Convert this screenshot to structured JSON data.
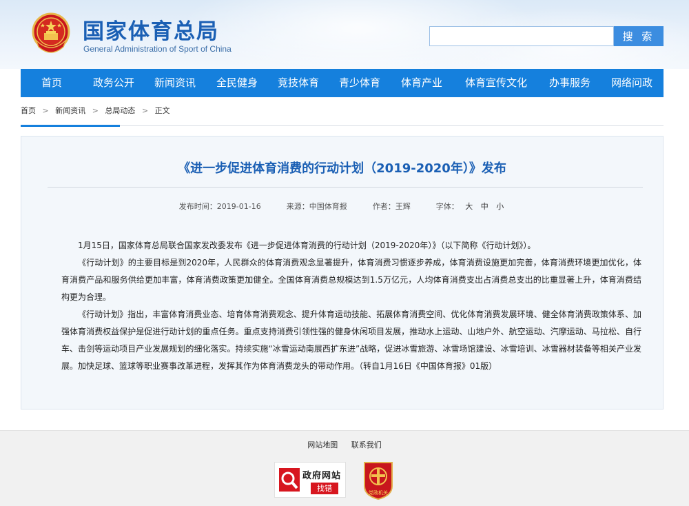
{
  "header": {
    "site_title": "国家体育总局",
    "site_subtitle": "General Administration of Sport of China",
    "search_placeholder": "",
    "search_button": "搜 索"
  },
  "nav": {
    "items": [
      "首页",
      "政务公开",
      "新闻资讯",
      "全民健身",
      "竞技体育",
      "青少体育",
      "体育产业",
      "体育宣传文化",
      "办事服务",
      "网络问政"
    ]
  },
  "breadcrumb": {
    "items": [
      "首页",
      "新闻资讯",
      "总局动态",
      "正文"
    ],
    "separator": ">"
  },
  "article": {
    "title": "《进一步促进体育消费的行动计划（2019-2020年）》发布",
    "publish_time_label": "发布时间：",
    "publish_time": "2019-01-16",
    "source_label": "来源：",
    "source": "中国体育报",
    "author_label": "作者：",
    "author": "王辉",
    "font_size_label": "字体：",
    "font_sizes": [
      "大",
      "中",
      "小"
    ],
    "paragraphs": [
      "1月15日，国家体育总局联合国家发改委发布《进一步促进体育消费的行动计划（2019-2020年）》（以下简称《行动计划》）。",
      "《行动计划》的主要目标是到2020年，人民群众的体育消费观念显著提升，体育消费习惯逐步养成，体育消费设施更加完善，体育消费环境更加优化，体育消费产品和服务供给更加丰富，体育消费政策更加健全。全国体育消费总规模达到1.5万亿元，人均体育消费支出占消费总支出的比重显著上升，体育消费结构更为合理。",
      "《行动计划》指出，丰富体育消费业态、培育体育消费观念、提升体育运动技能、拓展体育消费空间、优化体育消费发展环境、健全体育消费政策体系、加强体育消费权益保护是促进行动计划的重点任务。重点支持消费引领性强的健身休闲项目发展，推动水上运动、山地户外、航空运动、汽摩运动、马拉松、自行车、击剑等运动项目产业发展规划的细化落实。持续实施“冰雪运动南展西扩东进”战略，促进冰雪旅游、冰雪场馆建设、冰雪培训、冰雪器材装备等相关产业发展。加快足球、篮球等职业赛事改革进程，发挥其作为体育消费龙头的带动作用。（转自1月16日《中国体育报》01版）"
    ]
  },
  "footer": {
    "links": [
      "网站地图",
      "联系我们"
    ],
    "gov_badge_line1": "政府网站",
    "gov_badge_line2": "找错",
    "party_badge_text": "党政机关"
  },
  "colors": {
    "primary_blue": "#1580dd",
    "title_blue": "#1a5fb4",
    "badge_red": "#d7161f"
  }
}
